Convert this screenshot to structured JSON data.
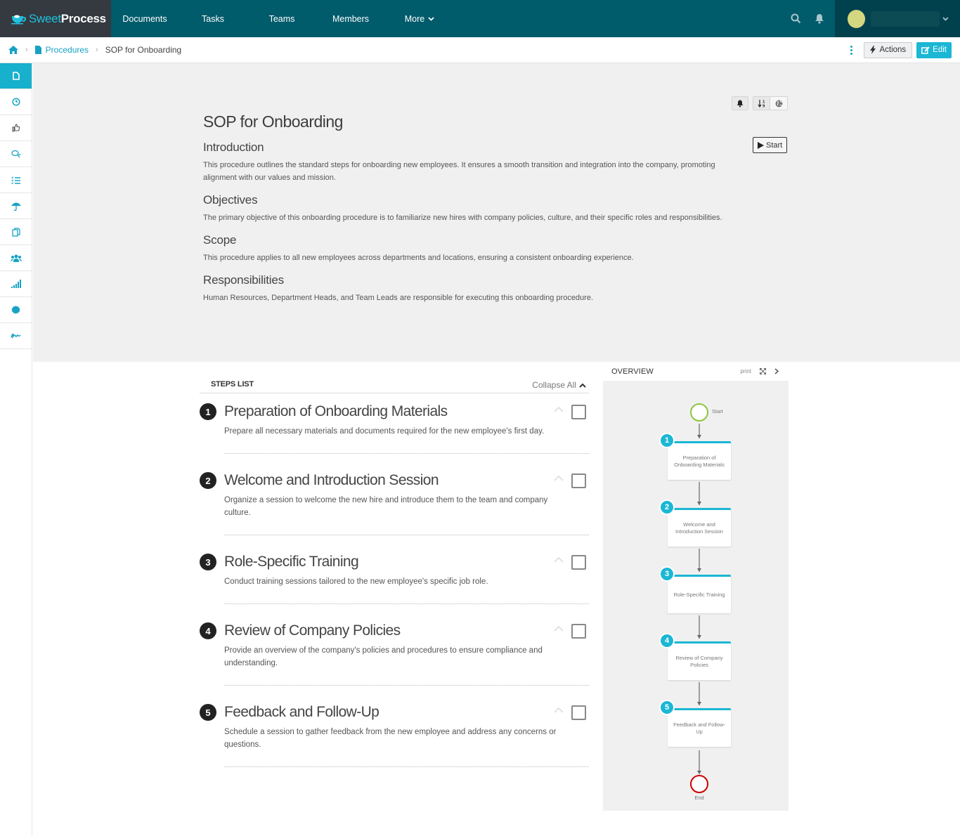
{
  "app": {
    "brand_sweet": "Sweet",
    "brand_process": "Process",
    "accent_color": "#17b0cd",
    "topbar_color": "#005b6b"
  },
  "nav": {
    "items": [
      {
        "label": "Documents"
      },
      {
        "label": "Tasks"
      },
      {
        "label": "Teams"
      },
      {
        "label": "Members"
      },
      {
        "label": "More"
      }
    ],
    "icons": [
      "search-icon",
      "bell-icon"
    ],
    "user_menu_icon": "chevron-down-icon"
  },
  "breadcrumb": {
    "home_icon": "home-icon",
    "items": [
      {
        "label": "Procedures",
        "icon": "document-icon"
      },
      {
        "label": "SOP for Onboarding"
      }
    ],
    "actions_label": "Actions",
    "edit_label": "Edit"
  },
  "sidebar": {
    "items": [
      {
        "icon": "document-icon",
        "active": true
      },
      {
        "icon": "clock-icon"
      },
      {
        "icon": "thumbs-up-icon"
      },
      {
        "icon": "comments-icon"
      },
      {
        "icon": "checklist-icon"
      },
      {
        "icon": "umbrella-icon"
      },
      {
        "icon": "copy-icon"
      },
      {
        "icon": "users-icon"
      },
      {
        "icon": "signal-icon"
      },
      {
        "icon": "badge-icon"
      },
      {
        "icon": "signature-icon"
      }
    ]
  },
  "document": {
    "title": "SOP for Onboarding",
    "start_label": "Start",
    "sections": [
      {
        "heading": "Introduction",
        "text": "This procedure outlines the standard steps for onboarding new employees. It ensures a smooth transition and integration into the company, promoting alignment with our values and mission."
      },
      {
        "heading": "Objectives",
        "text": "The primary objective of this onboarding procedure is to familiarize new hires with company policies, culture, and their specific roles and responsibilities."
      },
      {
        "heading": "Scope",
        "text": "This procedure applies to all new employees across departments and locations, ensuring a consistent onboarding experience."
      },
      {
        "heading": "Responsibilities",
        "text": "Human Resources, Department Heads, and Team Leads are responsible for executing this onboarding procedure."
      }
    ]
  },
  "steps_list": {
    "title": "STEPS LIST",
    "collapse_label": "Collapse All",
    "steps": [
      {
        "num": "1",
        "title": "Preparation of Onboarding Materials",
        "desc": "Prepare all necessary materials and documents required for the new employee's first day.",
        "checked": false
      },
      {
        "num": "2",
        "title": "Welcome and Introduction Session",
        "desc": "Organize a session to welcome the new hire and introduce them to the team and company culture.",
        "checked": false
      },
      {
        "num": "3",
        "title": "Role-Specific Training",
        "desc": "Conduct training sessions tailored to the new employee's specific job role.",
        "checked": false
      },
      {
        "num": "4",
        "title": "Review of Company Policies",
        "desc": "Provide an overview of the company's policies and procedures to ensure compliance and understanding.",
        "checked": false
      },
      {
        "num": "5",
        "title": "Feedback and Follow-Up",
        "desc": "Schedule a session to gather feedback from the new employee and address any concerns or questions.",
        "checked": false
      }
    ]
  },
  "overview": {
    "title": "OVERVIEW",
    "print_label": "print",
    "start_label": "Start",
    "end_label": "End",
    "start_color": "#8cc63f",
    "end_color": "#cc0000",
    "nodes": [
      {
        "num": "1",
        "label": "Preparation of Onboarding Materials"
      },
      {
        "num": "2",
        "label": "Welcome and Introduction Session"
      },
      {
        "num": "3",
        "label": "Role-Specific Training"
      },
      {
        "num": "4",
        "label": "Review of Company Policies"
      },
      {
        "num": "5",
        "label": "Feedback and Follow-Up"
      }
    ]
  }
}
